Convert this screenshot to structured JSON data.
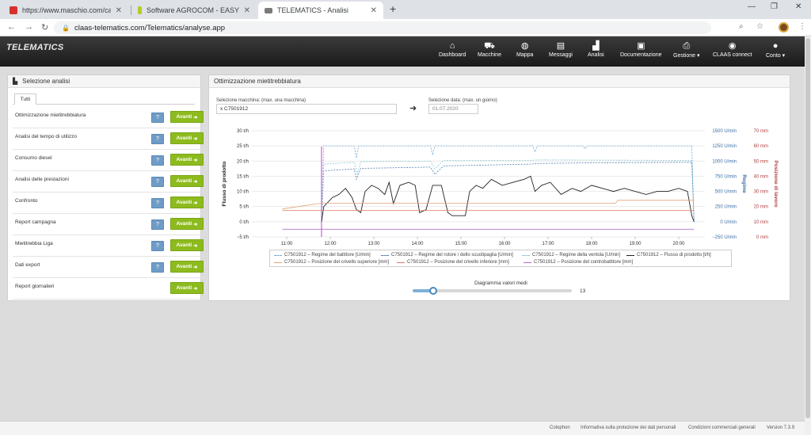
{
  "browser": {
    "tabs": [
      {
        "title": "https://www.maschio.com/catalo",
        "favicon_color": "#d7302c",
        "active": false
      },
      {
        "title": "Software AGROCOM - EASY | CLA",
        "favicon_color": "#b8c928",
        "active": false
      },
      {
        "title": "TELEMATICS - Analisi",
        "favicon_color": "#7a7a7a",
        "active": true
      }
    ],
    "url": "claas-telematics.com/Telematics/analyse.app"
  },
  "app": {
    "logo": "TELEMATICS",
    "nav": [
      {
        "label": "Dashboard",
        "icon": "home-icon"
      },
      {
        "label": "Macchine",
        "icon": "tractor-icon"
      },
      {
        "label": "Mappa",
        "icon": "globe-icon"
      },
      {
        "label": "Messaggi",
        "icon": "messages-icon"
      },
      {
        "label": "Analisi",
        "icon": "chart-icon"
      },
      {
        "label": "Documentazione",
        "icon": "document-icon"
      },
      {
        "label": "Gestione ▾",
        "icon": "printer-icon"
      },
      {
        "label": "CLAAS connect",
        "icon": "connect-icon"
      },
      {
        "label": "Conto ▾",
        "icon": "user-icon"
      }
    ]
  },
  "left_panel": {
    "title": "Selezione analisi",
    "tab": "Tutti",
    "items": [
      {
        "label": "Ottimizzazione mietitrebbiatura",
        "help": "?",
        "button": "Avanti"
      },
      {
        "label": "Analisi del tempo di utilizzo",
        "help": "?",
        "button": "Avanti"
      },
      {
        "label": "Consumo diesel",
        "help": "?",
        "button": "Avanti"
      },
      {
        "label": "Analisi delle prestazioni",
        "help": "?",
        "button": "Avanti"
      },
      {
        "label": "Confronto",
        "help": "?",
        "button": "Avanti"
      },
      {
        "label": "Report campagna",
        "help": "?",
        "button": "Avanti"
      },
      {
        "label": "Mietitrebbia Liga",
        "help": "?",
        "button": "Avanti"
      },
      {
        "label": "Dati export",
        "help": "?",
        "button": "Avanti"
      },
      {
        "label": "Report giornalieri",
        "help": "",
        "button": "Avanti"
      }
    ]
  },
  "right_panel": {
    "title": "Ottimizzazione mietitrebbiatura",
    "machine_label": "Selezione macchina: (max. una macchina)",
    "machine_value": "x C7501912",
    "date_label": "Selezione data: (max. un giorno)",
    "date_value": "01.07.2020",
    "slider_label": "Diagramma valori medi",
    "slider_value": "13",
    "slider_fraction": 0.13
  },
  "chart_data": {
    "type": "line",
    "x_ticks": [
      "11:00",
      "12:00",
      "13:00",
      "14:00",
      "15:00",
      "16:00",
      "17:00",
      "18:00",
      "19:00",
      "20:00"
    ],
    "left_axis": {
      "label": "Flusso di prodotto",
      "ticks": [
        "30 t/h",
        "25 t/h",
        "20 t/h",
        "15 t/h",
        "10 t/h",
        "5 t/h",
        "0 t/h",
        "−5 t/h"
      ],
      "range": [
        -5,
        30
      ]
    },
    "right_axis_1": {
      "label": "Regime",
      "ticks": [
        "1500 U/min",
        "1250 U/min",
        "1000 U/min",
        "750 U/min",
        "500 U/min",
        "250 U/min",
        "0 U/min",
        "−250 U/min"
      ],
      "range": [
        -250,
        1500
      ]
    },
    "right_axis_2": {
      "label": "Posizione di lavoro",
      "ticks": [
        "70 mm",
        "60 mm",
        "50 mm",
        "40 mm",
        "30 mm",
        "20 mm",
        "10 mm",
        "0 mm"
      ],
      "range": [
        0,
        70
      ]
    },
    "grid": true,
    "legend_position": "bottom",
    "series": [
      {
        "name": "C7501912 – Regime del battitore [U/min]",
        "color": "#6fa9d8",
        "dash": true,
        "axis": "rpm",
        "points": [
          [
            11.8,
            0
          ],
          [
            11.85,
            1250
          ],
          [
            12.55,
            1250
          ],
          [
            12.6,
            1050
          ],
          [
            12.65,
            1250
          ],
          [
            14.3,
            1250
          ],
          [
            14.35,
            1100
          ],
          [
            14.4,
            1250
          ],
          [
            16.65,
            1250
          ],
          [
            16.7,
            1150
          ],
          [
            16.75,
            1250
          ],
          [
            17.8,
            1250
          ],
          [
            17.85,
            1200
          ],
          [
            17.9,
            1250
          ],
          [
            20.3,
            1250
          ],
          [
            20.35,
            0
          ]
        ]
      },
      {
        "name": "C7501912 – Regime del rotore / dello scuotipaglia [U/min]",
        "color": "#4f7fb0",
        "dash": true,
        "axis": "rpm",
        "points": [
          [
            11.8,
            0
          ],
          [
            11.85,
            840
          ],
          [
            12.55,
            870
          ],
          [
            12.6,
            700
          ],
          [
            12.7,
            880
          ],
          [
            14.3,
            900
          ],
          [
            14.4,
            780
          ],
          [
            14.6,
            920
          ],
          [
            16.6,
            950
          ],
          [
            16.8,
            960
          ],
          [
            17.8,
            970
          ],
          [
            20.3,
            980
          ],
          [
            20.35,
            0
          ]
        ]
      },
      {
        "name": "C7501912 – Regime della ventola [U/min]",
        "color": "#8cc6d6",
        "dash": true,
        "axis": "rpm",
        "points": [
          [
            11.8,
            0
          ],
          [
            11.85,
            950
          ],
          [
            12.55,
            980
          ],
          [
            12.62,
            780
          ],
          [
            12.7,
            990
          ],
          [
            14.3,
            1000
          ],
          [
            14.4,
            870
          ],
          [
            14.6,
            1010
          ],
          [
            16.6,
            1010
          ],
          [
            16.75,
            1020
          ],
          [
            20.3,
            1010
          ],
          [
            20.35,
            0
          ]
        ]
      },
      {
        "name": "C7501912 – Flusso di prodotto [t/h]",
        "color": "#222222",
        "dash": false,
        "axis": "flow",
        "points": [
          [
            11.8,
            0
          ],
          [
            11.85,
            5
          ],
          [
            12.05,
            8
          ],
          [
            12.2,
            9
          ],
          [
            12.35,
            11
          ],
          [
            12.5,
            8
          ],
          [
            12.6,
            4
          ],
          [
            12.7,
            3
          ],
          [
            12.8,
            10
          ],
          [
            12.95,
            12
          ],
          [
            13.1,
            11
          ],
          [
            13.25,
            9
          ],
          [
            13.35,
            13
          ],
          [
            13.45,
            6
          ],
          [
            13.6,
            12
          ],
          [
            13.8,
            13
          ],
          [
            13.95,
            12
          ],
          [
            14.05,
            3
          ],
          [
            14.2,
            4
          ],
          [
            14.35,
            12
          ],
          [
            14.55,
            12
          ],
          [
            14.7,
            3
          ],
          [
            14.8,
            2
          ],
          [
            15.1,
            2
          ],
          [
            15.2,
            10
          ],
          [
            15.35,
            12
          ],
          [
            15.5,
            11
          ],
          [
            15.7,
            14
          ],
          [
            15.95,
            12
          ],
          [
            16.2,
            13
          ],
          [
            16.45,
            14
          ],
          [
            16.6,
            15
          ],
          [
            16.7,
            10
          ],
          [
            16.85,
            12
          ],
          [
            17.05,
            13
          ],
          [
            17.3,
            9
          ],
          [
            17.55,
            11
          ],
          [
            17.75,
            10
          ],
          [
            18.0,
            12
          ],
          [
            18.25,
            11
          ],
          [
            18.5,
            10
          ],
          [
            18.75,
            11
          ],
          [
            19.0,
            10
          ],
          [
            19.25,
            9
          ],
          [
            19.5,
            10
          ],
          [
            19.75,
            10
          ],
          [
            20.0,
            11
          ],
          [
            20.2,
            10
          ],
          [
            20.3,
            2
          ],
          [
            20.35,
            0
          ]
        ]
      },
      {
        "name": "C7501912 – Posizione del crivello superiore [mm]",
        "color": "#e5a27a",
        "dash": false,
        "axis": "mm",
        "points": [
          [
            10.9,
            16
          ],
          [
            11.8,
            20
          ],
          [
            12.0,
            20
          ],
          [
            18.55,
            20
          ],
          [
            18.6,
            22
          ],
          [
            20.35,
            22
          ]
        ]
      },
      {
        "name": "C7501912 – Posizione del crivello inferiore [mm]",
        "color": "#e07b6a",
        "dash": false,
        "axis": "mm",
        "points": [
          [
            10.9,
            15
          ],
          [
            20.35,
            15
          ]
        ]
      },
      {
        "name": "C7501912 – Posizione del controbattitore [mm]",
        "color": "#b06fc7",
        "dash": false,
        "axis": "mm",
        "points": [
          [
            10.9,
            2
          ],
          [
            20.35,
            2
          ]
        ]
      }
    ]
  },
  "footer": {
    "colophon": "Colophon",
    "privacy": "Informativa sulla protezione dei dati personali",
    "terms": "Condizioni commerciali generali",
    "version": "Version 7.3.9"
  }
}
